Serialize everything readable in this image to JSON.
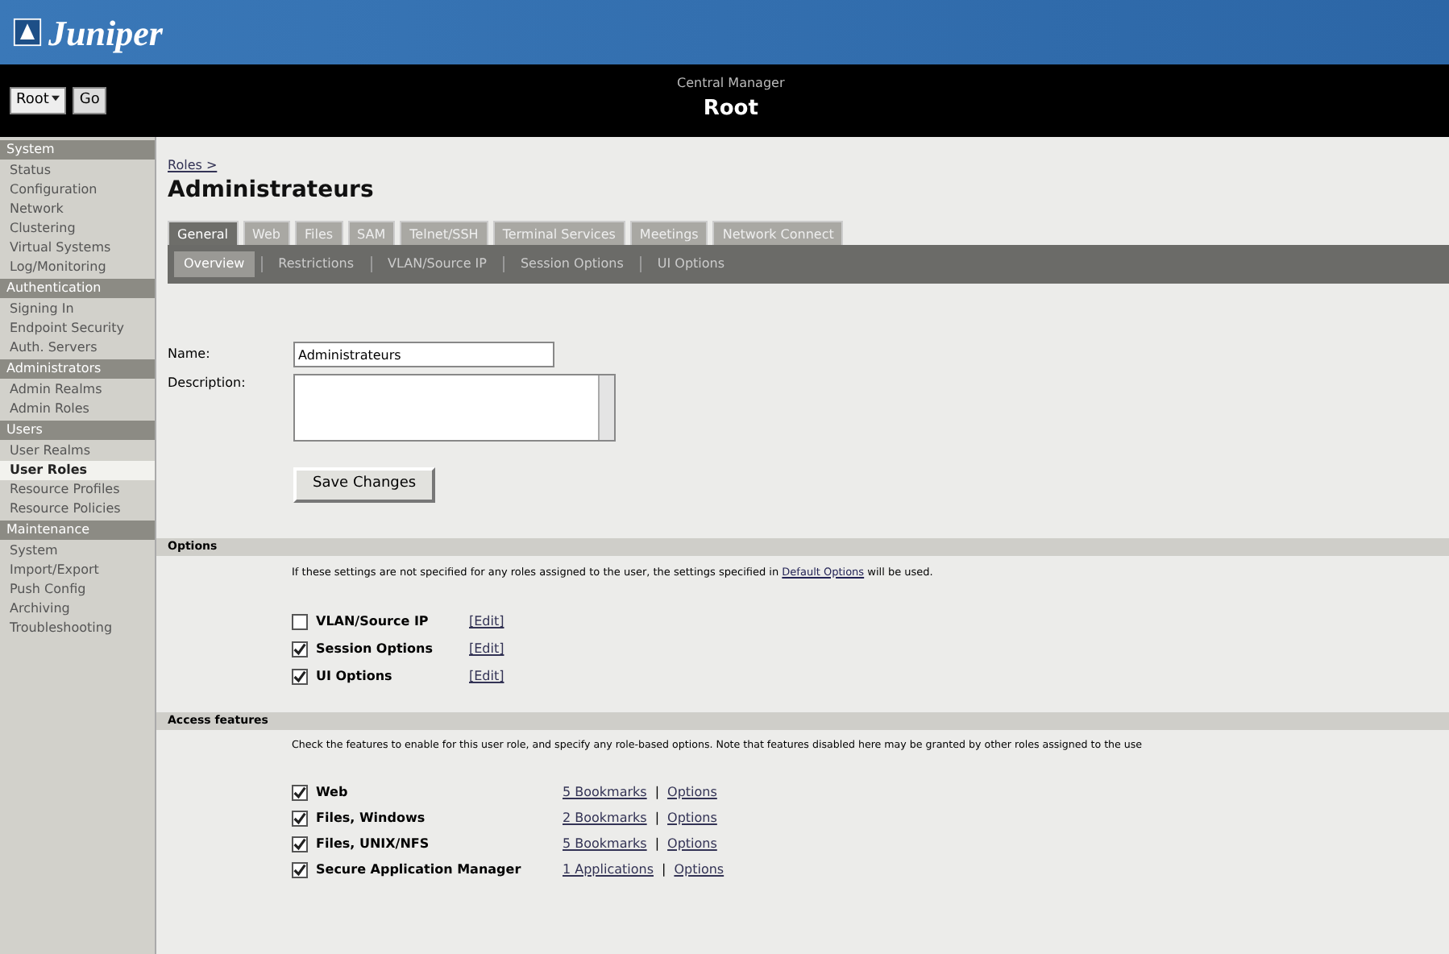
{
  "logo": "Juniper",
  "header": {
    "subtitle": "Central Manager",
    "title": "Root",
    "selector": "Root",
    "go": "Go"
  },
  "sidebar": [
    {
      "title": "System",
      "items": [
        {
          "label": "Status",
          "selected": false
        },
        {
          "label": "Configuration",
          "selected": false
        },
        {
          "label": "Network",
          "selected": false
        },
        {
          "label": "Clustering",
          "selected": false
        },
        {
          "label": "Virtual Systems",
          "selected": false
        },
        {
          "label": "Log/Monitoring",
          "selected": false
        }
      ]
    },
    {
      "title": "Authentication",
      "items": [
        {
          "label": "Signing In",
          "selected": false
        },
        {
          "label": "Endpoint Security",
          "selected": false
        },
        {
          "label": "Auth. Servers",
          "selected": false
        }
      ]
    },
    {
      "title": "Administrators",
      "items": [
        {
          "label": "Admin Realms",
          "selected": false
        },
        {
          "label": "Admin Roles",
          "selected": false
        }
      ]
    },
    {
      "title": "Users",
      "items": [
        {
          "label": "User Realms",
          "selected": false
        },
        {
          "label": "User Roles",
          "selected": true
        },
        {
          "label": "Resource Profiles",
          "selected": false
        },
        {
          "label": "Resource Policies",
          "selected": false
        }
      ]
    },
    {
      "title": "Maintenance",
      "items": [
        {
          "label": "System",
          "selected": false
        },
        {
          "label": "Import/Export",
          "selected": false
        },
        {
          "label": "Push Config",
          "selected": false
        },
        {
          "label": "Archiving",
          "selected": false
        },
        {
          "label": "Troubleshooting",
          "selected": false
        }
      ]
    }
  ],
  "breadcrumb": "Roles >",
  "page_title": "Administrateurs",
  "tabs": [
    {
      "label": "General",
      "selected": true
    },
    {
      "label": "Web",
      "selected": false
    },
    {
      "label": "Files",
      "selected": false
    },
    {
      "label": "SAM",
      "selected": false
    },
    {
      "label": "Telnet/SSH",
      "selected": false
    },
    {
      "label": "Terminal Services",
      "selected": false
    },
    {
      "label": "Meetings",
      "selected": false
    },
    {
      "label": "Network Connect",
      "selected": false
    }
  ],
  "subtabs": [
    {
      "label": "Overview",
      "selected": true
    },
    {
      "label": "Restrictions",
      "selected": false
    },
    {
      "label": "VLAN/Source IP",
      "selected": false
    },
    {
      "label": "Session Options",
      "selected": false
    },
    {
      "label": "UI Options",
      "selected": false
    }
  ],
  "form": {
    "name_label": "Name:",
    "name_value": "Administrateurs",
    "description_label": "Description:",
    "save": "Save Changes"
  },
  "options": {
    "title": "Options",
    "note_before": "If these settings are not specified for any roles assigned to the user, the settings specified in",
    "note_link": "Default Options",
    "note_after": "will be used.",
    "items": [
      {
        "label": "VLAN/Source IP",
        "checked": false,
        "link": "[Edit]"
      },
      {
        "label": "Session Options",
        "checked": true,
        "link": "[Edit]"
      },
      {
        "label": "UI Options",
        "checked": true,
        "link": "[Edit]"
      }
    ]
  },
  "access": {
    "title": "Access features",
    "note": "Check the features to enable for this user role, and specify any role-based options. Note that features disabled here may be granted by other roles assigned to the use",
    "items": [
      {
        "label": "Web",
        "checked": true,
        "link": "5 Bookmarks",
        "separator": "|",
        "options": "Options"
      },
      {
        "label": "Files, Windows",
        "checked": true,
        "link": "2 Bookmarks",
        "separator": "|",
        "options": "Options"
      },
      {
        "label": "Files, UNIX/NFS",
        "checked": true,
        "link": "5 Bookmarks",
        "separator": "|",
        "options": "Options"
      },
      {
        "label": "Secure Application Manager",
        "checked": true,
        "link": "1 Applications",
        "separator": "|",
        "options": "Options"
      }
    ]
  }
}
